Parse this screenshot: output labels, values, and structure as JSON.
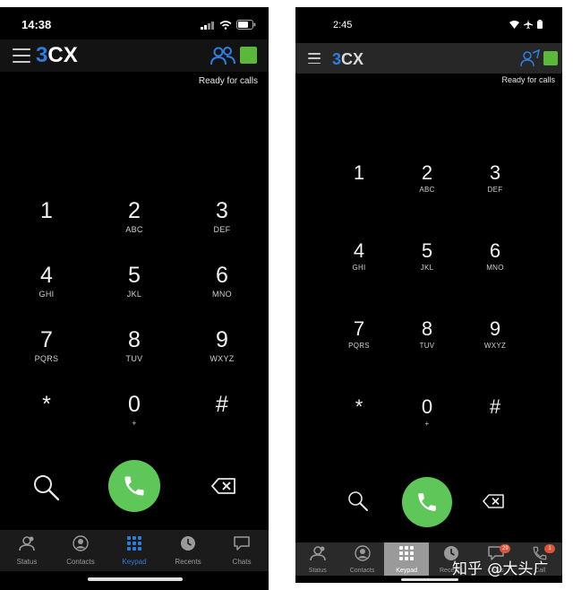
{
  "ios": {
    "status_time": "14:38",
    "logo_3": "3",
    "logo_cx": "CX",
    "ready_text": "Ready for calls",
    "keys": [
      {
        "num": "1",
        "letters": ""
      },
      {
        "num": "2",
        "letters": "ABC"
      },
      {
        "num": "3",
        "letters": "DEF"
      },
      {
        "num": "4",
        "letters": "GHI"
      },
      {
        "num": "5",
        "letters": "JKL"
      },
      {
        "num": "6",
        "letters": "MNO"
      },
      {
        "num": "7",
        "letters": "PQRS"
      },
      {
        "num": "8",
        "letters": "TUV"
      },
      {
        "num": "9",
        "letters": "WXYZ"
      },
      {
        "num": "*",
        "letters": ""
      },
      {
        "num": "0",
        "letters": "+"
      },
      {
        "num": "#",
        "letters": ""
      }
    ],
    "tabs": [
      {
        "label": "Status",
        "icon": "status-icon"
      },
      {
        "label": "Contacts",
        "icon": "contacts-icon"
      },
      {
        "label": "Keypad",
        "icon": "keypad-icon",
        "active": true
      },
      {
        "label": "Recents",
        "icon": "recents-icon"
      },
      {
        "label": "Chats",
        "icon": "chats-icon"
      }
    ]
  },
  "android": {
    "status_time": "2:45",
    "logo_3": "3",
    "logo_cx": "CX",
    "ready_text": "Ready for calls",
    "keys": [
      {
        "num": "1",
        "letters": ""
      },
      {
        "num": "2",
        "letters": "ABC"
      },
      {
        "num": "3",
        "letters": "DEF"
      },
      {
        "num": "4",
        "letters": "GHI"
      },
      {
        "num": "5",
        "letters": "JKL"
      },
      {
        "num": "6",
        "letters": "MNO"
      },
      {
        "num": "7",
        "letters": "PQRS"
      },
      {
        "num": "8",
        "letters": "TUV"
      },
      {
        "num": "9",
        "letters": "WXYZ"
      },
      {
        "num": "*",
        "letters": ""
      },
      {
        "num": "0",
        "letters": "+"
      },
      {
        "num": "#",
        "letters": ""
      }
    ],
    "tabs": [
      {
        "label": "Status",
        "icon": "status-icon"
      },
      {
        "label": "Contacts",
        "icon": "contacts-icon"
      },
      {
        "label": "Keypad",
        "icon": "keypad-icon",
        "active": true
      },
      {
        "label": "Recents",
        "icon": "recents-icon"
      },
      {
        "label": "Chats",
        "icon": "chats-icon",
        "badge": "29"
      },
      {
        "label": "Call",
        "icon": "call-tab-icon",
        "badge": "1"
      }
    ]
  },
  "colors": {
    "accent": "#2f7de1",
    "presence": "#5cb83c",
    "call_button": "#5fc65a",
    "active_tab_ios": "#2f7de1",
    "active_tab_android_bg": "#9a9a9a"
  },
  "watermark": "知乎 @大头广"
}
